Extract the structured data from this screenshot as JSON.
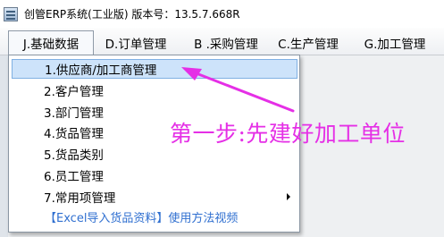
{
  "window": {
    "title": "创管ERP系统(工业版) 版本号：13.5.7.668R"
  },
  "menubar": {
    "items": [
      {
        "label": "J.基础数据",
        "active": true
      },
      {
        "label": "D.订单管理",
        "active": false
      },
      {
        "label": "B .采购管理",
        "active": false
      },
      {
        "label": "C.生产管理",
        "active": false
      },
      {
        "label": "G.加工管理",
        "active": false
      }
    ]
  },
  "dropdown": {
    "items": [
      {
        "label": "1.供应商/加工商管理",
        "highlighted": true
      },
      {
        "label": "2.客户管理"
      },
      {
        "label": "3.部门管理"
      },
      {
        "label": "4.货品管理"
      },
      {
        "label": "5.货品类别"
      },
      {
        "label": "6.员工管理"
      },
      {
        "label": "7.常用项管理",
        "has_submenu": true
      }
    ],
    "link": "【Excel导入货品资料】使用方法视频"
  },
  "annotation": {
    "text": "第一步:先建好加工单位",
    "color": "#e52fe6"
  },
  "icons": {
    "app": "app-icon",
    "submenu": "chevron-right-icon"
  }
}
